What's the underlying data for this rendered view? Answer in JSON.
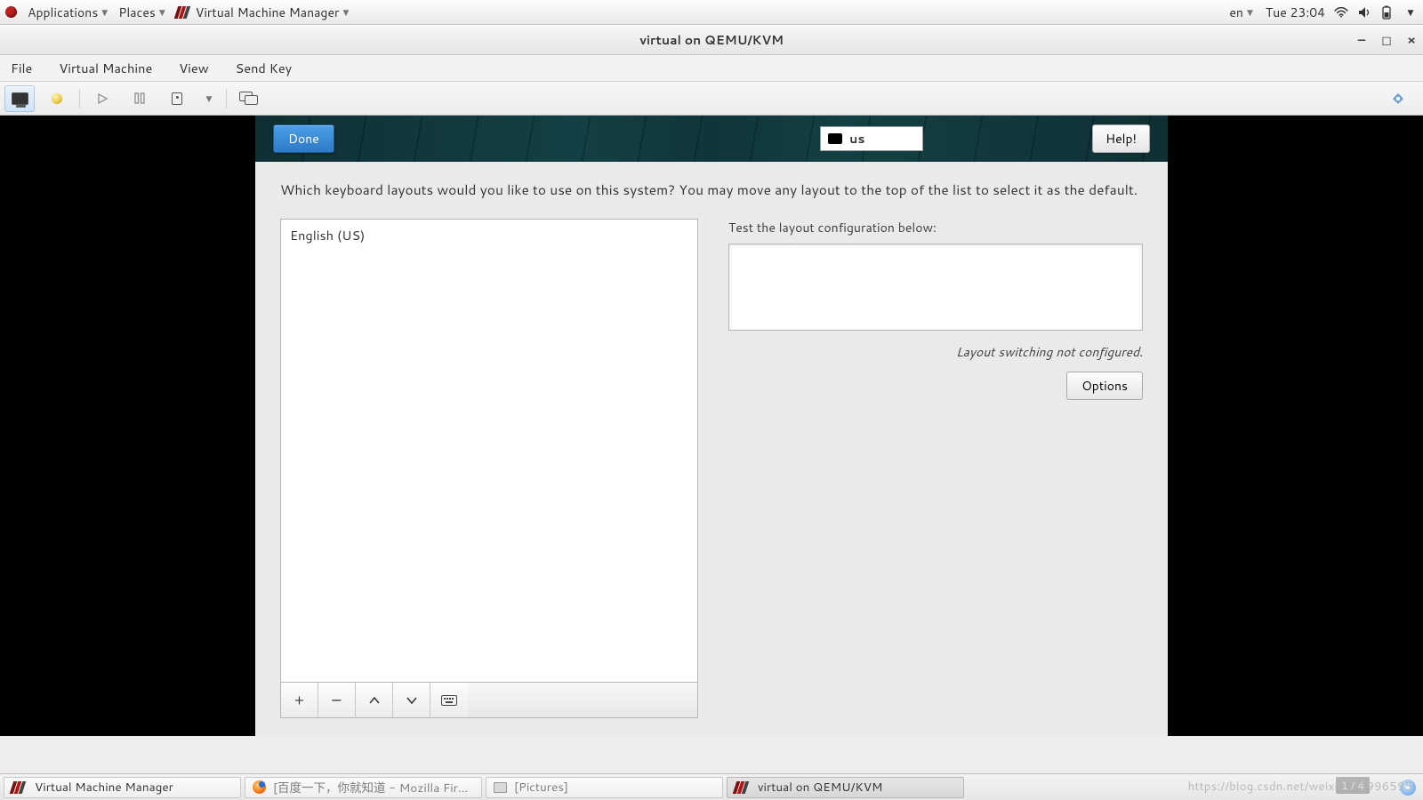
{
  "gnome_panel": {
    "applications": "Applications",
    "places": "Places",
    "vmm": "Virtual Machine Manager",
    "lang": "en",
    "clock": "Tue 23:04"
  },
  "window": {
    "title": "virtual on QEMU/KVM"
  },
  "menubar": {
    "file": "File",
    "vm": "Virtual Machine",
    "view": "View",
    "sendkey": "Send Key"
  },
  "anaconda": {
    "done": "Done",
    "kb_indicator": "us",
    "help": "Help!",
    "prompt": "Which keyboard layouts would you like to use on this system?  You may move any layout to the top of the list to select it as the default.",
    "layouts": [
      "English (US)"
    ],
    "test_label": "Test the layout configuration below:",
    "switching_note": "Layout switching not configured.",
    "options": "Options",
    "toolbar": {
      "add": "+",
      "remove": "−",
      "up": "⌃",
      "down": "⌄"
    }
  },
  "taskbar": {
    "items": [
      "Virtual Machine Manager",
      "[百度一下，你就知道 - Mozilla Fir...",
      "[Pictures]",
      "virtual on QEMU/KVM"
    ],
    "page_indicator": "1 / 4"
  },
  "watermark": "https://blog.csdn.net/weixin_43996595"
}
